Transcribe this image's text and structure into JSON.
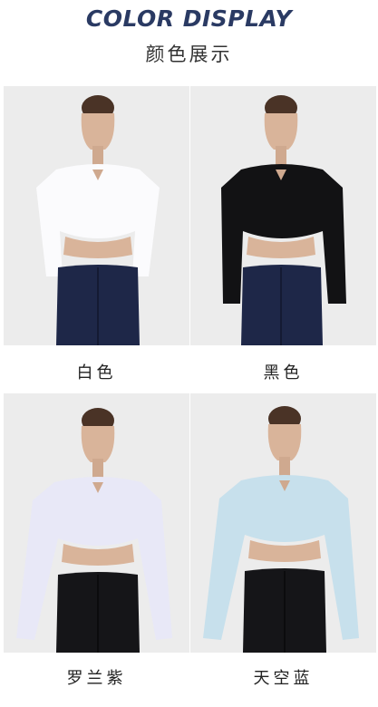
{
  "header": {
    "title": "COLOR DISPLAY",
    "subtitle": "颜色展示"
  },
  "variants": [
    {
      "label": "白色",
      "top_color": "#fbfbfd",
      "bottom_color": "#1e2748",
      "accent": "#dcdde4"
    },
    {
      "label": "黑色",
      "top_color": "#121214",
      "bottom_color": "#1e2748",
      "accent": "#2a2a2e"
    },
    {
      "label": "罗兰紫",
      "top_color": "#e8e8f7",
      "bottom_color": "#151518",
      "accent": "#cfd0e8"
    },
    {
      "label": "天空蓝",
      "top_color": "#c7e0ec",
      "bottom_color": "#151518",
      "accent": "#a9cadb"
    }
  ]
}
